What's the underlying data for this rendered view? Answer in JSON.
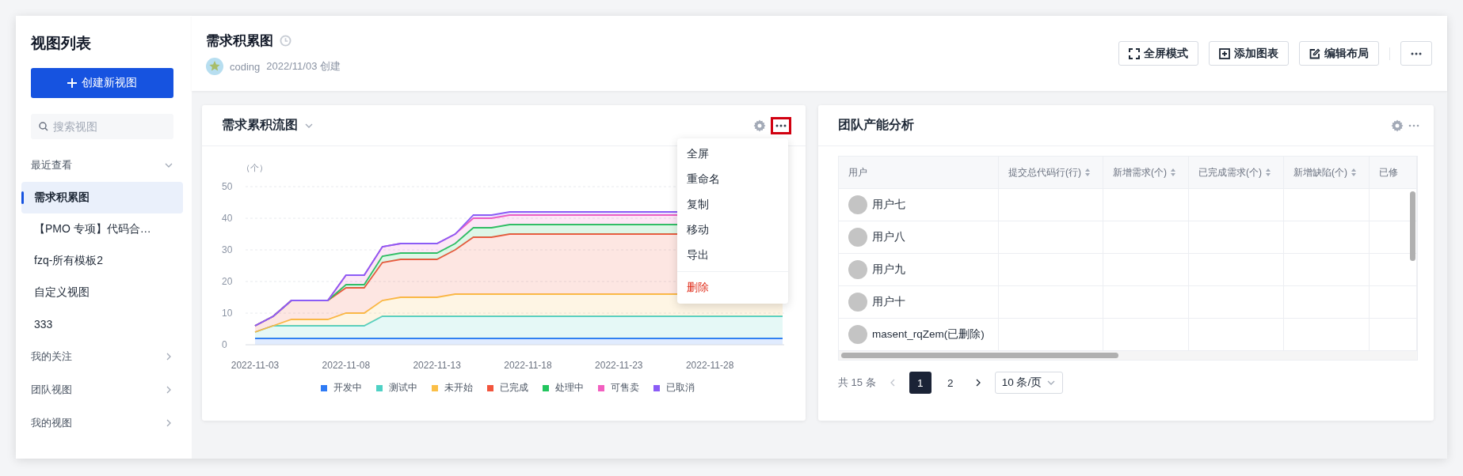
{
  "sidebar": {
    "title": "视图列表",
    "create_button": "创建新视图",
    "search": {
      "placeholder": "搜索视图"
    },
    "groups": [
      {
        "label": "最近查看",
        "expanded": true,
        "items": [
          {
            "label": "需求积累图",
            "selected": true
          },
          {
            "label": "【PMO 专项】代码合…",
            "selected": false
          },
          {
            "label": "fzq-所有模板2",
            "selected": false
          },
          {
            "label": "自定义视图",
            "selected": false
          },
          {
            "label": "333",
            "selected": false
          }
        ]
      },
      {
        "label": "我的关注",
        "expanded": false
      },
      {
        "label": "团队视图",
        "expanded": false
      },
      {
        "label": "我的视图",
        "expanded": false
      }
    ]
  },
  "header": {
    "title": "需求积累图",
    "author": "coding",
    "created": "2022/11/03 创建",
    "buttons": [
      {
        "kind": "fullscreen",
        "label": "全屏模式"
      },
      {
        "kind": "add",
        "label": "添加图表"
      },
      {
        "kind": "edit",
        "label": "编辑布局"
      },
      {
        "kind": "more"
      }
    ]
  },
  "chart_card": {
    "title": "需求累积流图",
    "menu_open": true,
    "menu": [
      {
        "label": "全屏",
        "kind": "normal"
      },
      {
        "label": "重命名",
        "kind": "normal"
      },
      {
        "label": "复制",
        "kind": "normal"
      },
      {
        "label": "移动",
        "kind": "normal"
      },
      {
        "label": "导出",
        "kind": "normal"
      },
      {
        "label": "删除",
        "kind": "danger"
      }
    ],
    "chart_data": {
      "type": "area",
      "ylabel": "（个）",
      "stacked": true,
      "grid": true,
      "legend": "bottom",
      "ylim": [
        0,
        50
      ],
      "yticks": [
        0,
        10,
        20,
        30,
        40,
        50
      ],
      "categories": [
        "2022-11-03",
        null,
        null,
        null,
        null,
        "2022-11-08",
        null,
        null,
        null,
        null,
        "2022-11-13",
        null,
        null,
        null,
        null,
        "2022-11-18",
        null,
        null,
        null,
        null,
        "2022-11-23",
        null,
        null,
        null,
        null,
        "2022-11-28",
        null,
        null,
        null,
        null
      ],
      "series": [
        {
          "name": "开发中",
          "color": "#2f7bf5",
          "values": [
            2,
            2,
            2,
            2,
            2,
            2,
            2,
            2,
            2,
            2,
            2,
            2,
            2,
            2,
            2,
            2,
            2,
            2,
            2,
            2,
            2,
            2,
            2,
            2,
            2,
            2,
            2,
            2,
            2,
            2
          ]
        },
        {
          "name": "测试中",
          "color": "#4fd1c5",
          "values": [
            2,
            4,
            4,
            4,
            4,
            4,
            4,
            7,
            7,
            7,
            7,
            7,
            7,
            7,
            7,
            7,
            7,
            7,
            7,
            7,
            7,
            7,
            7,
            7,
            7,
            7,
            7,
            7,
            7,
            7
          ]
        },
        {
          "name": "未开始",
          "color": "#fbbf47",
          "values": [
            0,
            0,
            2,
            2,
            2,
            4,
            4,
            5,
            6,
            6,
            6,
            7,
            7,
            7,
            7,
            7,
            7,
            7,
            7,
            7,
            7,
            7,
            7,
            7,
            7,
            7,
            7,
            7,
            7,
            7
          ]
        },
        {
          "name": "已完成",
          "color": "#f2553d",
          "values": [
            2,
            3,
            6,
            6,
            6,
            8,
            8,
            12,
            12,
            12,
            12,
            14,
            18,
            18,
            19,
            19,
            19,
            19,
            19,
            19,
            19,
            19,
            19,
            19,
            19,
            19,
            19,
            19,
            19,
            19
          ]
        },
        {
          "name": "处理中",
          "color": "#22c55e",
          "values": [
            0,
            0,
            0,
            0,
            0,
            1,
            1,
            2,
            2,
            2,
            2,
            2,
            3,
            3,
            3,
            3,
            3,
            3,
            3,
            3,
            3,
            3,
            3,
            3,
            3,
            3,
            3,
            3,
            3,
            3
          ]
        },
        {
          "name": "可售卖",
          "color": "#f25fc0",
          "values": [
            0,
            0,
            0,
            0,
            0,
            3,
            3,
            3,
            3,
            3,
            3,
            3,
            3,
            3,
            3,
            3,
            3,
            3,
            3,
            3,
            3,
            3,
            3,
            3,
            3,
            3,
            3,
            3,
            3,
            3
          ]
        },
        {
          "name": "已取消",
          "color": "#8b5cf6",
          "values": [
            0,
            0,
            0,
            0,
            0,
            0,
            0,
            0,
            0,
            0,
            0,
            0,
            1,
            1,
            1,
            1,
            1,
            1,
            1,
            1,
            1,
            1,
            1,
            1,
            1,
            1,
            1,
            1,
            1,
            1
          ]
        }
      ]
    }
  },
  "table_card": {
    "title": "团队产能分析",
    "columns": [
      {
        "label": "用户",
        "sortable": false
      },
      {
        "label": "提交总代码行(行)",
        "sortable": true
      },
      {
        "label": "新增需求(个)",
        "sortable": true
      },
      {
        "label": "已完成需求(个)",
        "sortable": true
      },
      {
        "label": "新增缺陷(个)",
        "sortable": true
      },
      {
        "label": "已修",
        "sortable": false
      }
    ],
    "rows": [
      {
        "user": "用户七"
      },
      {
        "user": "用户八"
      },
      {
        "user": "用户九"
      },
      {
        "user": "用户十"
      },
      {
        "user": "masent_rqZem(已删除)"
      }
    ],
    "pagination": {
      "total": "共 15 条",
      "pages": [
        {
          "label": "1",
          "selected": true
        },
        {
          "label": "2",
          "selected": false
        }
      ],
      "prev_disabled": true,
      "page_size": "10 条/页"
    }
  }
}
